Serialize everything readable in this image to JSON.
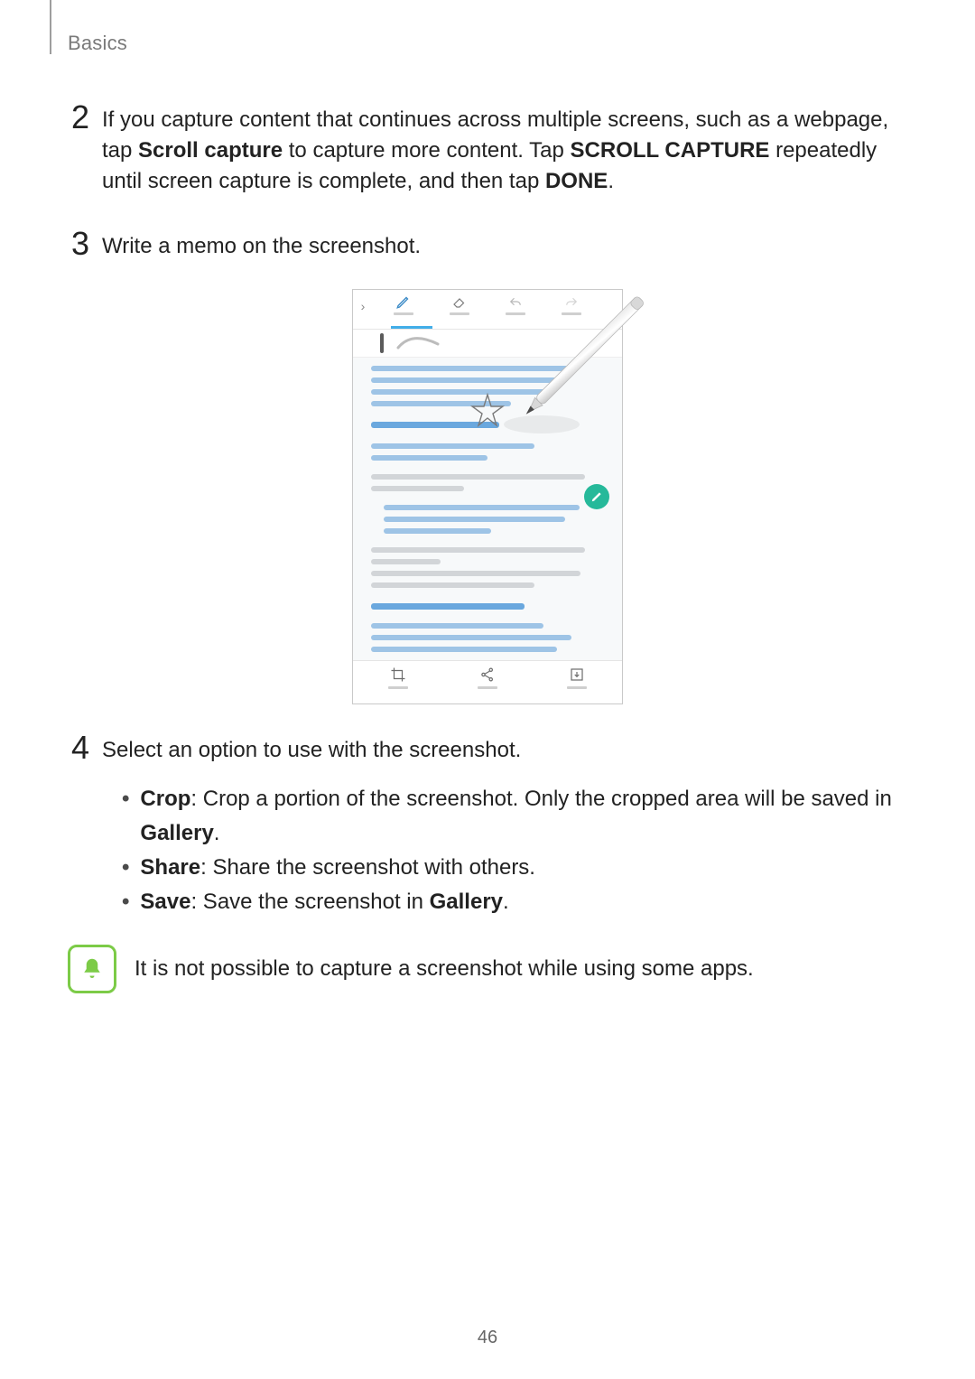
{
  "header": {
    "section": "Basics"
  },
  "steps": {
    "s2": {
      "num": "2",
      "pre": "If you capture content that continues across multiple screens, such as a webpage, tap ",
      "b1": "Scroll capture",
      "mid1": " to capture more content. Tap ",
      "b2": "SCROLL CAPTURE",
      "mid2": " repeatedly until screen capture is complete, and then tap ",
      "b3": "DONE",
      "end": "."
    },
    "s3": {
      "num": "3",
      "text": "Write a memo on the screenshot."
    },
    "s4": {
      "num": "4",
      "text": "Select an option to use with the screenshot."
    }
  },
  "options": {
    "crop": {
      "label": "Crop",
      "desc_pre": ": Crop a portion of the screenshot. Only the cropped area will be saved in ",
      "desc_b": "Gallery",
      "desc_end": "."
    },
    "share": {
      "label": "Share",
      "desc": ": Share the screenshot with others."
    },
    "save": {
      "label": "Save",
      "desc_pre": ": Save the screenshot in ",
      "desc_b": "Gallery",
      "desc_end": "."
    }
  },
  "note": {
    "text": "It is not possible to capture a screenshot while using some apps."
  },
  "illustration": {
    "top_tools": [
      "pen",
      "eraser",
      "undo",
      "redo"
    ],
    "bottom_tools": [
      "crop",
      "share",
      "save"
    ]
  },
  "page_number": "46"
}
